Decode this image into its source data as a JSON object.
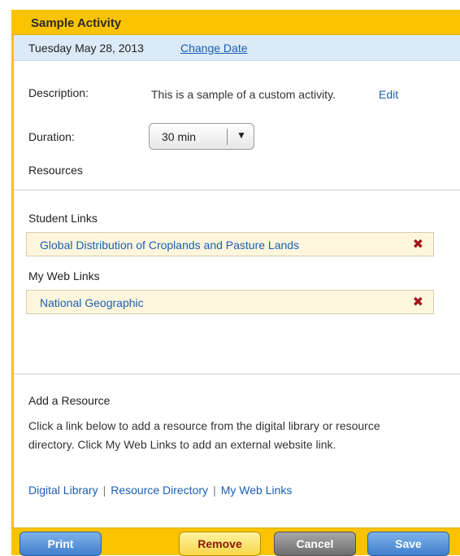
{
  "window": {
    "title": "Sample Activity"
  },
  "date_bar": {
    "date": "Tuesday May 28, 2013",
    "change_date": "Change Date"
  },
  "form": {
    "description_label": "Description:",
    "description_text": "This is a sample of a custom activity.",
    "edit_label": "Edit",
    "duration_label": "Duration:",
    "duration_value": "30 min",
    "resources_heading": "Resources"
  },
  "student_links": {
    "heading": "Student Links",
    "items": [
      {
        "label": "Global Distribution of Croplands and Pasture Lands"
      }
    ]
  },
  "web_links": {
    "heading": "My Web Links",
    "items": [
      {
        "label": "National Geographic"
      }
    ]
  },
  "add_resource": {
    "heading": "Add a Resource",
    "help_line1": "Click a link below to add a resource from the digital library or resource",
    "help_line2": "directory. Click My Web Links to add an external website link.",
    "links": [
      "Digital Library",
      "Resource Directory",
      "My Web Links"
    ],
    "separator": "|"
  },
  "footer": {
    "print": "Print",
    "remove": "Remove",
    "cancel": "Cancel",
    "save": "Save"
  },
  "icons": {
    "remove_glyph": "✖",
    "dropdown_glyph": "▼"
  },
  "colors": {
    "accent": "#f9c300",
    "date_bar": "#dbeaf6",
    "link": "#1a5fb4",
    "resource_row": "#fdf6dc"
  }
}
